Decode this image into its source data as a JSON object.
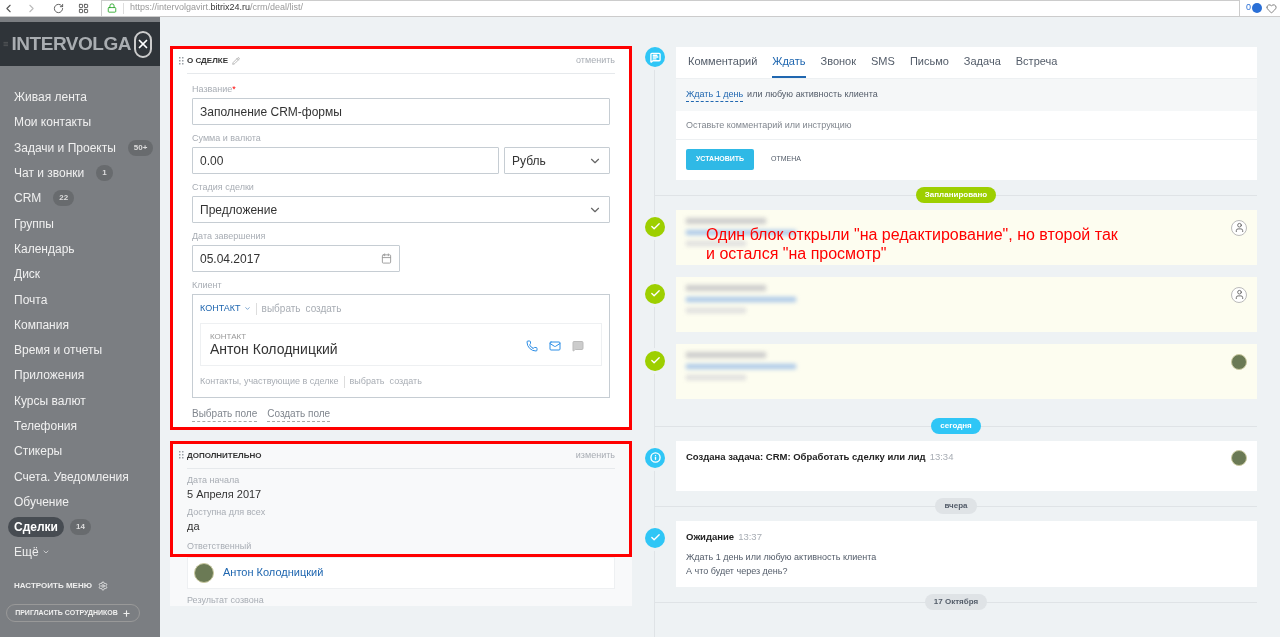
{
  "browser": {
    "url_prefix": "https://intervolgavirt.",
    "url_domain": "bitrix24.ru",
    "url_path": "/crm/deal/list/",
    "badge": "0"
  },
  "sidebar": {
    "logo": "INTERVOLGA",
    "items": [
      {
        "label": "Живая лента",
        "selected": false
      },
      {
        "label": "Мои контакты",
        "selected": false
      },
      {
        "label": "Задачи и Проекты",
        "counter": "50+",
        "selected": false
      },
      {
        "label": "Чат и звонки",
        "counter": "1",
        "selected": false
      },
      {
        "label": "CRM",
        "counter": "22",
        "selected": false
      },
      {
        "label": "Группы",
        "selected": false
      },
      {
        "label": "Календарь",
        "selected": false
      },
      {
        "label": "Диск",
        "selected": false
      },
      {
        "label": "Почта",
        "selected": false
      },
      {
        "label": "Компания",
        "selected": false
      },
      {
        "label": "Время и отчеты",
        "selected": false
      },
      {
        "label": "Приложения",
        "selected": false
      },
      {
        "label": "Курсы валют",
        "selected": false
      },
      {
        "label": "Телефония",
        "selected": false
      },
      {
        "label": "Стикеры",
        "selected": false
      },
      {
        "label": "Счета. Уведомления",
        "selected": false
      },
      {
        "label": "Обучение",
        "selected": false
      },
      {
        "label": "Сделки",
        "counter": "14",
        "selected": true
      }
    ],
    "more": "Ещё",
    "configure": "НАСТРОИТЬ МЕНЮ",
    "invite": "ПРИГЛАСИТЬ СОТРУДНИКОВ"
  },
  "deal_section": {
    "title": "О СДЕЛКЕ",
    "action": "отменить",
    "name": {
      "label": "Название",
      "required_mark": "*",
      "value": "Заполнение CRM-формы"
    },
    "amount": {
      "label": "Сумма и валюта",
      "value": "0.00",
      "currency": "Рубль"
    },
    "stage": {
      "label": "Стадия сделки",
      "value": "Предложение"
    },
    "close_date": {
      "label": "Дата завершения",
      "value": "05.04.2017"
    },
    "client": {
      "label": "Клиент",
      "type_label": "КОНТАКТ",
      "actions": [
        "выбрать",
        "создать"
      ],
      "contact_caption": "КОНТАКТ",
      "contact_name": "Антон Колодницкий",
      "participants_label": "Контакты, участвующие в сделке",
      "participant_actions": [
        "выбрать",
        "создать"
      ]
    },
    "footer_links": [
      "Выбрать поле",
      "Создать поле"
    ]
  },
  "extra_section": {
    "title": "ДОПОЛНИТЕЛЬНО",
    "action": "изменить",
    "fields": [
      {
        "label": "Дата начала",
        "value": "5 Апреля 2017"
      },
      {
        "label": "Доступна для всех",
        "value": "да"
      }
    ],
    "responsible_label": "Ответственный",
    "responsible_name": "Антон Колодницкий",
    "next_label": "Результат созвона"
  },
  "composer": {
    "tabs": [
      {
        "label": "Комментарий",
        "selected": false
      },
      {
        "label": "Ждать",
        "selected": true
      },
      {
        "label": "Звонок",
        "selected": false
      },
      {
        "label": "SMS",
        "selected": false
      },
      {
        "label": "Письмо",
        "selected": false
      },
      {
        "label": "Задача",
        "selected": false
      },
      {
        "label": "Встреча",
        "selected": false
      }
    ],
    "wait_link": "Ждать 1 день",
    "wait_rest": "или любую активность клиента",
    "placeholder": "Оставьте комментарий или инструкцию",
    "submit": "УСТАНОВИТЬ",
    "cancel": "ОТМЕНА"
  },
  "timeline": [
    {
      "kind": "divider",
      "label": "Запланировано",
      "color": "#9dcf00"
    },
    {
      "kind": "blurred",
      "avatar": true,
      "annotation": "Один блок открыли \"на редактирование\", но второй так и остался \"на просмотр\""
    },
    {
      "kind": "blurred",
      "avatar": true
    },
    {
      "kind": "blurred",
      "avatar": true
    },
    {
      "kind": "divider",
      "label": "сегодня",
      "color": "#2fc6f6"
    },
    {
      "kind": "info",
      "title": "Создана задача: CRM: Обработать сделку или лид",
      "time": "13:34",
      "avatar": true
    },
    {
      "kind": "divider",
      "label": "вчера",
      "color": "#dfe3e6"
    },
    {
      "kind": "done",
      "title": "Ожидание",
      "time": "13:37",
      "avatar": false,
      "lines": [
        "Ждать 1 день или любую активность клиента",
        "А что будет через день?"
      ]
    },
    {
      "kind": "divider",
      "label": "17 Октября",
      "color": "#dfe3e6"
    }
  ]
}
